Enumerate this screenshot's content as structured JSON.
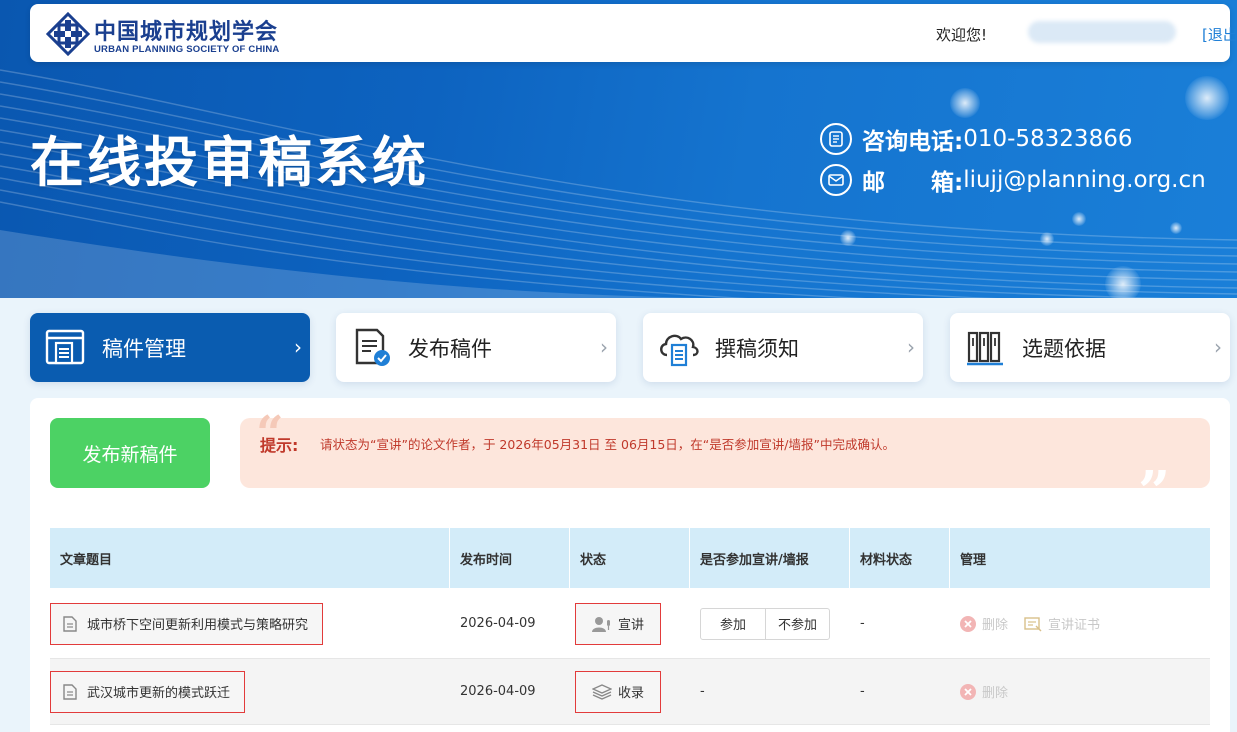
{
  "header": {
    "logo_cn": "中国城市规划学会",
    "logo_en": "URBAN PLANNING SOCIETY OF CHINA",
    "welcome": "欢迎您!",
    "logout": "[退出]"
  },
  "banner": {
    "title": "在线投审稿系统",
    "phone_label": "咨询电话:",
    "phone": "010-58323866",
    "email_label": "邮　　箱:",
    "email": "liujj@planning.org.cn"
  },
  "nav": [
    {
      "label": "稿件管理",
      "active": true
    },
    {
      "label": "发布稿件",
      "active": false
    },
    {
      "label": "撰稿须知",
      "active": false
    },
    {
      "label": "选题依据",
      "active": false
    }
  ],
  "publish_button": "发布新稿件",
  "notice": {
    "label": "提示:",
    "text": "请状态为“宣讲”的论文作者，于 2026年05月31日 至 06月15日，在“是否参加宣讲/墙报”中完成确认。"
  },
  "table": {
    "headers": [
      "文章题目",
      "发布时间",
      "状态",
      "是否参加宣讲/墙报",
      "材料状态",
      "管理"
    ],
    "rows": [
      {
        "title": "城市桥下空间更新利用模式与策略研究",
        "date": "2026-04-09",
        "status": "宣讲",
        "join_yes": "参加",
        "join_no": "不参加",
        "material": "-",
        "delete": "删除",
        "certificate": "宣讲证书"
      },
      {
        "title": "武汉城市更新的模式跃迁",
        "date": "2026-04-09",
        "status": "收录",
        "join": "-",
        "material": "-",
        "delete": "删除"
      }
    ]
  },
  "colors": {
    "banner_blue": "#0d63c0",
    "active_nav": "#0a5cb0",
    "publish_green": "#4cd264",
    "notice_bg": "#fde6dc",
    "notice_text": "#c0392b",
    "table_header_bg": "#d3ecf9",
    "highlight_border": "#e23b3b"
  }
}
